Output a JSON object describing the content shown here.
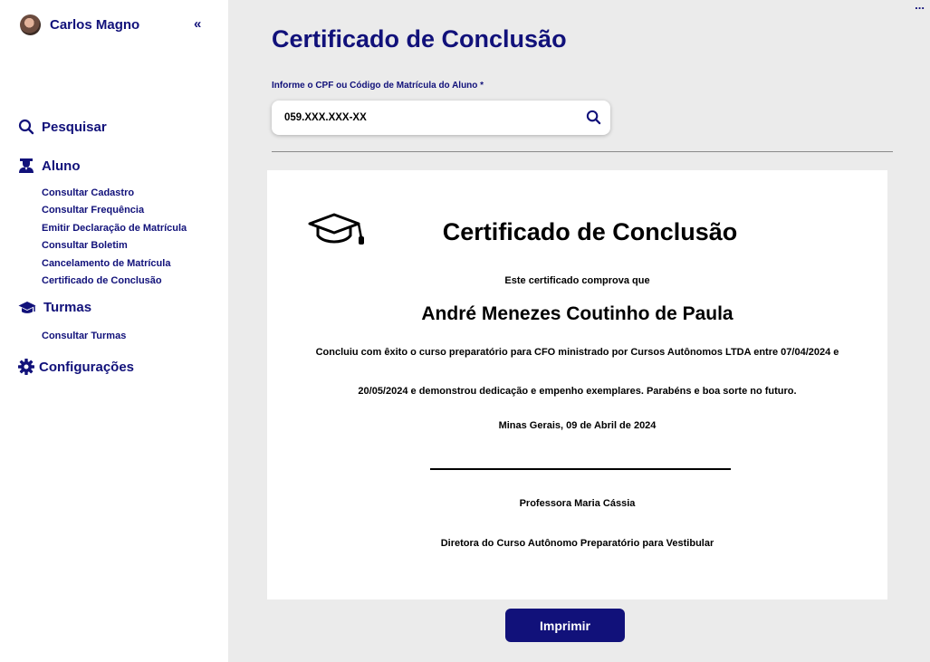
{
  "sidebar": {
    "user_name": "Carlos Magno",
    "collapse_label": "«",
    "search_label": "Pesquisar",
    "aluno": {
      "label": "Aluno",
      "items": [
        "Consultar Cadastro",
        "Consultar Frequência",
        "Emitir Declaração de Matrícula",
        "Consultar Boletim",
        "Cancelamento de Matrícula",
        "Certificado de Conclusão"
      ]
    },
    "turmas": {
      "label": "Turmas",
      "items": [
        "Consultar Turmas"
      ]
    },
    "config_label": "Configurações"
  },
  "header": {
    "more_label": "...",
    "title": "Certificado de Conclusão"
  },
  "search": {
    "label": "Informe o CPF ou Código de Matrícula do Aluno *",
    "value": "059.XXX.XXX-XX"
  },
  "certificate": {
    "title": "Certificado de Conclusão",
    "intro": "Este certificado comprova que",
    "student_name": "André Menezes Coutinho de Paula",
    "body_line1": "Concluiu com êxito o curso preparatório para CFO ministrado por Cursos Autônomos LTDA entre 07/04/2024 e",
    "body_line2": "20/05/2024 e demonstrou dedicação e empenho exemplares. Parabéns e boa sorte no futuro.",
    "place_date": "Minas Gerais, 09 de Abril de 2024",
    "signer": "Professora Maria Cássia",
    "signer_role": "Diretora do Curso Autônomo Preparatório para Vestibular"
  },
  "actions": {
    "print_label": "Imprimir"
  },
  "colors": {
    "primary": "#11117a",
    "background": "#ebebeb",
    "surface": "#ffffff"
  }
}
